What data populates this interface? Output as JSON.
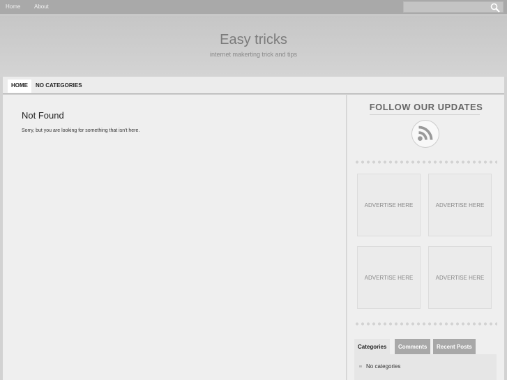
{
  "topbar": {
    "links": [
      "Home",
      "About"
    ],
    "search_placeholder": ""
  },
  "header": {
    "title": "Easy tricks",
    "tagline": "internet makerting trick and tips"
  },
  "nav": {
    "items": [
      "HOME",
      "NO CATEGORIES"
    ]
  },
  "main": {
    "title": "Not Found",
    "text": "Sorry, but you are looking for something that isn't here."
  },
  "sidebar": {
    "follow": "FOLLOW OUR UPDATES",
    "ads": [
      "ADVERTISE HERE",
      "ADVERTISE HERE",
      "ADVERTISE HERE",
      "ADVERTISE HERE"
    ],
    "tabs": [
      "Categories",
      "Comments",
      "Recent Posts"
    ],
    "categories_empty": "No categories"
  }
}
